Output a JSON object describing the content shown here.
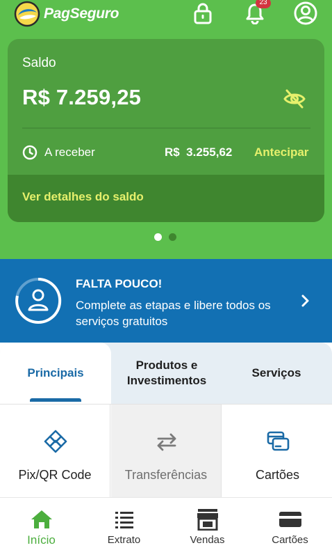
{
  "header": {
    "brand": "PagSeguro",
    "notification_count": "23"
  },
  "balance_card": {
    "label": "Saldo",
    "balance": "R$ 7.259,25",
    "receivable_label": "A receber",
    "receivable_value": "R$  3.255,62",
    "anticipate_label": "Antecipar",
    "details_link": "Ver detalhes do saldo"
  },
  "carousel": {
    "pages": 2,
    "active_page": 1
  },
  "banner": {
    "title": "FALTA POUCO!",
    "text": "Complete as etapas e libere todos os serviços gratuitos"
  },
  "tabs": [
    {
      "label": "Principais",
      "active": true
    },
    {
      "label": "Produtos e Investimentos",
      "active": false
    },
    {
      "label": "Serviços",
      "active": false
    }
  ],
  "tiles": [
    {
      "label": "Pix/QR Code",
      "icon": "pix-icon"
    },
    {
      "label": "Transferências",
      "icon": "transfer-icon"
    },
    {
      "label": "Cartões",
      "icon": "cards-icon"
    }
  ],
  "bottom_nav": [
    {
      "label": "Início",
      "icon": "home-icon",
      "active": true
    },
    {
      "label": "Extrato",
      "icon": "statement-icon",
      "active": false
    },
    {
      "label": "Vendas",
      "icon": "store-icon",
      "active": false
    },
    {
      "label": "Cartões",
      "icon": "card-icon",
      "active": false
    }
  ],
  "colors": {
    "header_green": "#5cbf4d",
    "card_green": "#4f9f40",
    "accent_yellow": "#e6f06c",
    "banner_blue": "#1270b3",
    "tab_blue": "#1a6aa6",
    "active_nav_green": "#4cae3e"
  }
}
